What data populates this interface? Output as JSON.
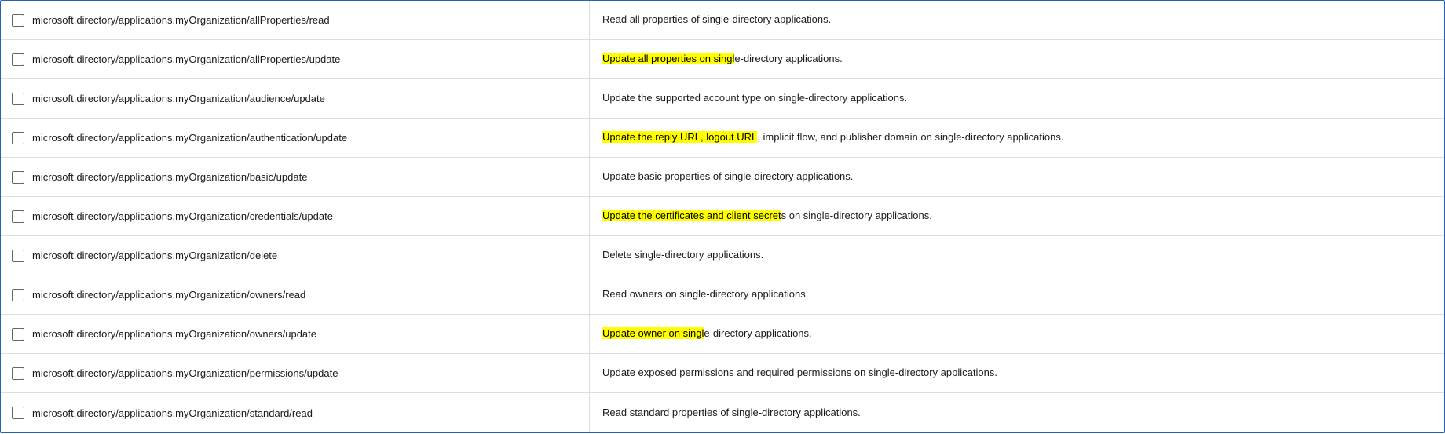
{
  "rows": [
    {
      "id": "row-1",
      "permission": "microsoft.directory/applications.myOrganization/allProperties/read",
      "description": "Read all properties of single-directory applications.",
      "highlight": null
    },
    {
      "id": "row-2",
      "permission": "microsoft.directory/applications.myOrganization/allProperties/update",
      "description_parts": [
        {
          "text": "Update all properties on singl",
          "highlighted": true
        },
        {
          "text": "e-directory applications.",
          "highlighted": false
        }
      ],
      "highlight": "allProperties"
    },
    {
      "id": "row-3",
      "permission": "microsoft.directory/applications.myOrganization/audience/update",
      "description": "Update the supported account type on single-directory applications.",
      "highlight": null
    },
    {
      "id": "row-4",
      "permission": "microsoft.directory/applications.myOrganization/authentication/update",
      "description_parts": [
        {
          "text": "Update the reply URL, logout URL",
          "highlighted": true
        },
        {
          "text": ", implicit flow, and publisher domain on single-directory applications.",
          "highlighted": false
        }
      ],
      "highlight": "authentication"
    },
    {
      "id": "row-5",
      "permission": "microsoft.directory/applications.myOrganization/basic/update",
      "description": "Update basic properties of single-directory applications.",
      "highlight": null
    },
    {
      "id": "row-6",
      "permission": "microsoft.directory/applications.myOrganization/credentials/update",
      "description_parts": [
        {
          "text": "Update the certificates and client secret",
          "highlighted": true
        },
        {
          "text": "s on single-directory applications.",
          "highlighted": false
        }
      ],
      "highlight": "credentials"
    },
    {
      "id": "row-7",
      "permission": "microsoft.directory/applications.myOrganization/delete",
      "description": "Delete single-directory applications.",
      "highlight": null
    },
    {
      "id": "row-8",
      "permission": "microsoft.directory/applications.myOrganization/owners/read",
      "description": "Read owners on single-directory applications.",
      "highlight": null
    },
    {
      "id": "row-9",
      "permission": "microsoft.directory/applications.myOrganization/owners/update",
      "description_parts": [
        {
          "text": "Update owner on singl",
          "highlighted": true
        },
        {
          "text": "e-directory applications.",
          "highlighted": false
        }
      ],
      "highlight": "owners"
    },
    {
      "id": "row-10",
      "permission": "microsoft.directory/applications.myOrganization/permissions/update",
      "description": "Update exposed permissions and required permissions on single-directory applications.",
      "highlight": null
    },
    {
      "id": "row-11",
      "permission": "microsoft.directory/applications.myOrganization/standard/read",
      "description": "Read standard properties of single-directory applications.",
      "highlight": null
    }
  ]
}
